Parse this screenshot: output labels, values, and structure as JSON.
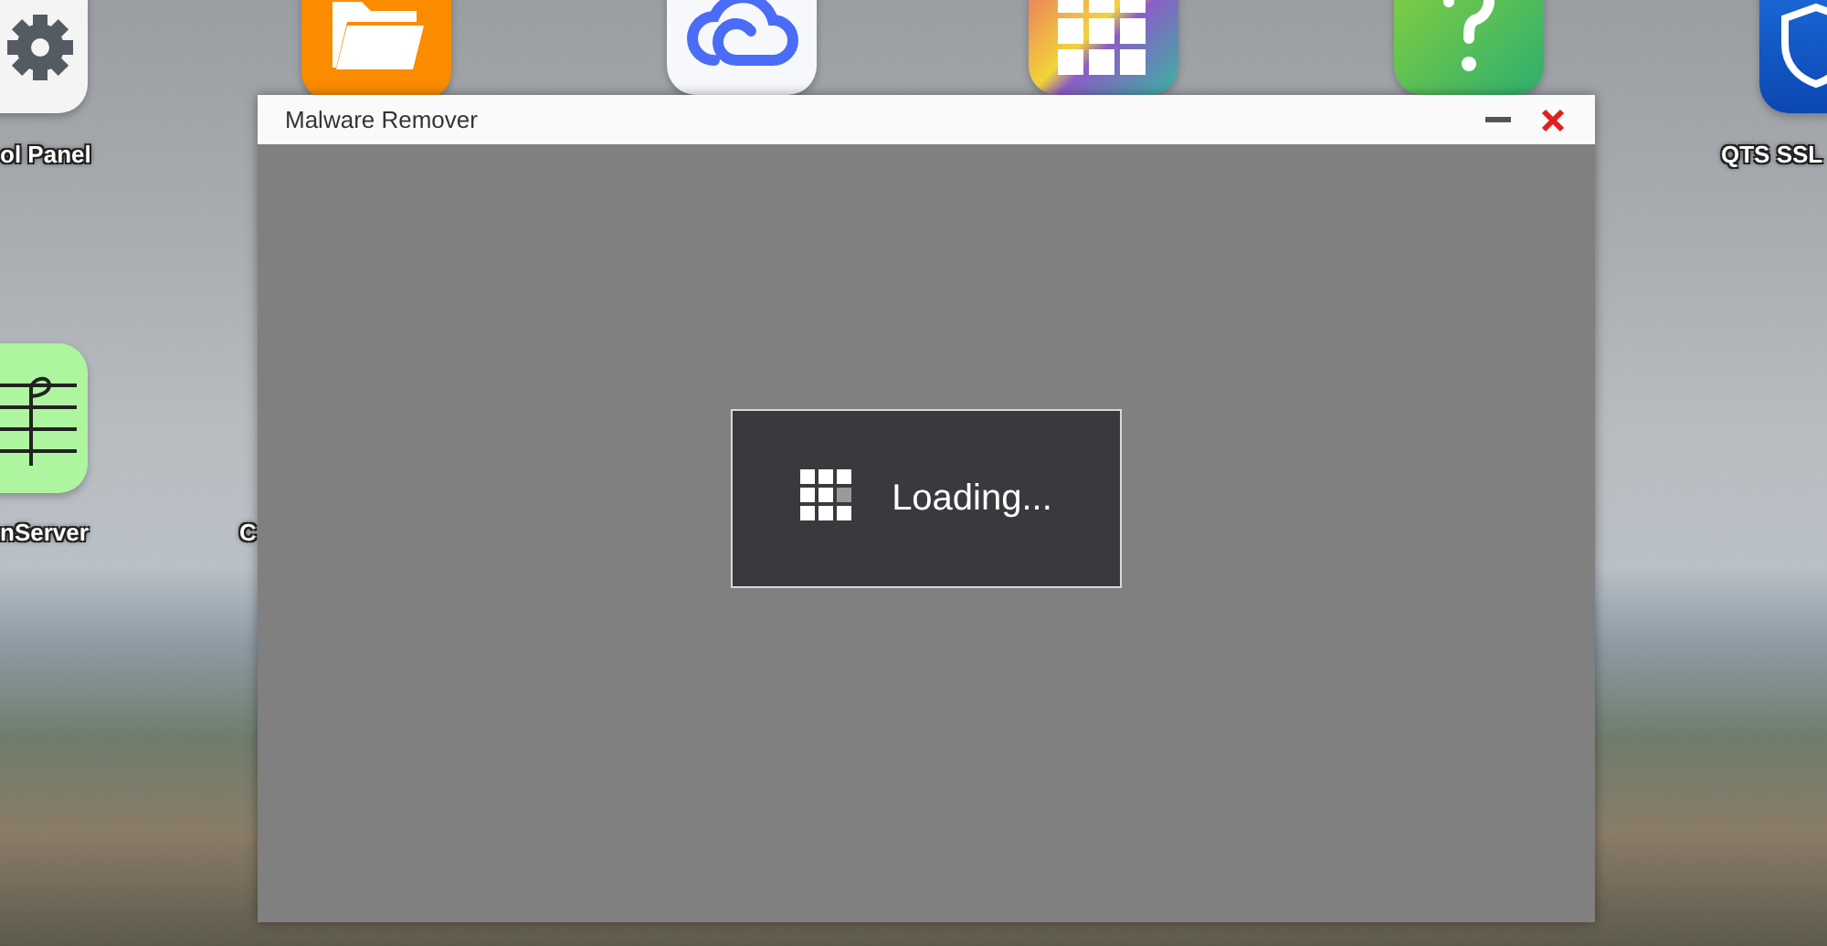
{
  "desktop_icons": [
    {
      "kind": "gear",
      "label": "ol Panel"
    },
    {
      "kind": "folder"
    },
    {
      "kind": "cloud"
    },
    {
      "kind": "grid"
    },
    {
      "kind": "help"
    },
    {
      "kind": "shield",
      "label": "QTS SSL"
    },
    {
      "kind": "music",
      "label": "nServer"
    },
    {
      "kind": "hidden",
      "label": "C"
    }
  ],
  "window": {
    "title": "Malware Remover",
    "loading": {
      "text": "Loading..."
    }
  }
}
